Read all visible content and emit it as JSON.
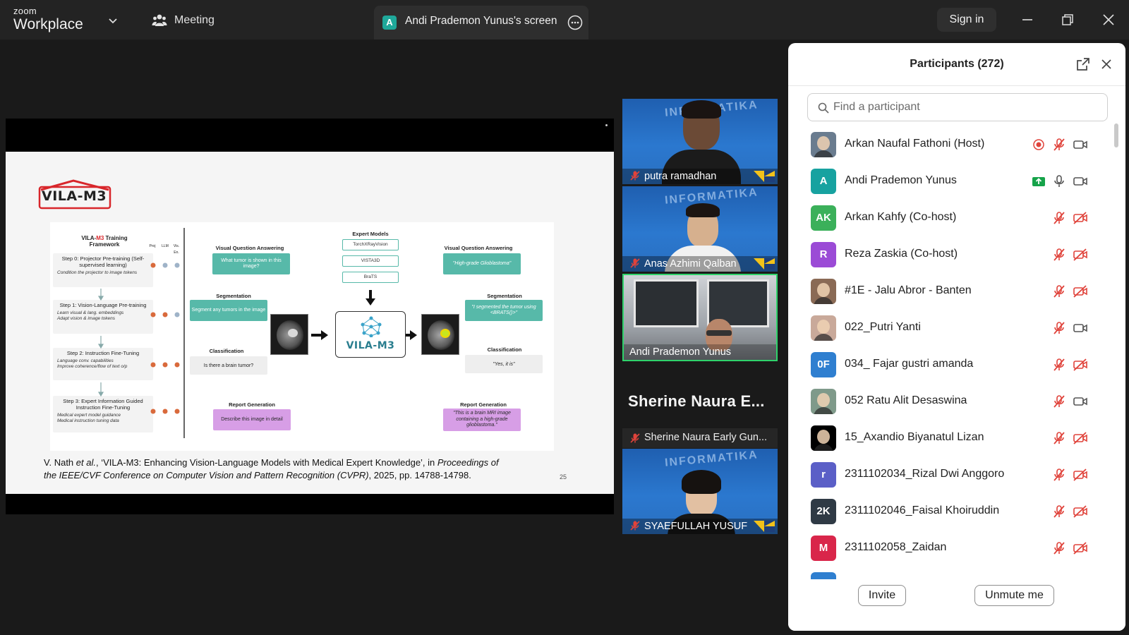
{
  "window": {
    "app_small": "zoom",
    "app_big": "Workplace",
    "meeting_label": "Meeting",
    "screen_badge": "A",
    "screen_label": "Andi Prademon Yunus's screen",
    "signin_label": "Sign in"
  },
  "slide": {
    "logo_text": "VILA-M3",
    "page_number": "25",
    "citation_line1_prefix": "V. Nath ",
    "citation_line1_etal": "et al.",
    "citation_line1_mid": ", ‘VILA-M3: Enhancing Vision-Language Models with Medical Expert Knowledge’, in ",
    "citation_line1_proc": "Proceedings of",
    "citation_line2_italic": "the IEEE/CVF Conference on Computer Vision and Pattern Recognition (CVPR)",
    "citation_line2_rest": ", 2025, pp. 14788-14798.",
    "figure": {
      "framework_title_a": "VILA-",
      "framework_title_b": "M3",
      "framework_title_c": " Training",
      "framework_title_d": "Framework",
      "col_headers": [
        "Proj",
        "LLM",
        "Vis. En."
      ],
      "steps": [
        {
          "title": "Step 0: Projector Pre-training (Self-supervised learning)",
          "bullets": [
            "Condition the projector to image tokens"
          ]
        },
        {
          "title": "Step 1: Vision-Language Pre-training",
          "bullets": [
            "Learn visual & lang. embeddings",
            "Adapt vision & image tokens"
          ]
        },
        {
          "title": "Step 2: Instruction Fine-Tuning",
          "bullets": [
            "Language conv. capabilities",
            "Improve coherence/flow of text o/p"
          ]
        },
        {
          "title": "Step 3: Expert Information Guided Instruction Fine-Tuning",
          "bullets": [
            "Medical expert model guidance",
            "Medical instruction tuning data"
          ]
        }
      ],
      "vqa_left_title": "Visual Question Answering",
      "vqa_left_box": "What tumor is shown in this image?",
      "seg_left_title": "Segmentation",
      "seg_left_box": "Segment any tumors in the image",
      "cls_left_title": "Classification",
      "cls_left_box": "Is there a brain tumor?",
      "rep_left_title": "Report Generation",
      "rep_left_box": "Describe this image in detail",
      "expert_title": "Expert Models",
      "expert_models": [
        "TorchXRayVision",
        "VISTA3D",
        "BraTS"
      ],
      "center_label": "VILA-M3",
      "vqa_right_title": "Visual Question Answering",
      "vqa_right_box": "\"High-grade Glioblastoma\"",
      "seg_right_title": "Segmentation",
      "seg_right_box": "\"I segmented the tumor using <BRATS()>\"",
      "cls_right_title": "Classification",
      "cls_right_box": "\"Yes, it is\"",
      "rep_right_title": "Report Generation",
      "rep_right_box": "\"This is a brain MRI image containing a high-grade glioblastoma.\""
    }
  },
  "videos": [
    {
      "name": "putra ramadhan",
      "banner": "INFORMATIKA"
    },
    {
      "name": "Anas Azhimi Qalban",
      "banner": "INFORMATIKA"
    },
    {
      "name": "Andi Prademon Yunus",
      "banner": ""
    },
    {
      "name": "SYAEFULLAH YUSUF",
      "banner": "INFORMATIKA"
    }
  ],
  "speaker_big_name": "Sherine Naura E...",
  "speaker_strip_name": "Sherine Naura Early Gun...",
  "participants_panel": {
    "title": "Participants (272)",
    "search_placeholder": "Find a participant",
    "invite_label": "Invite",
    "unmute_label": "Unmute me",
    "participants": [
      {
        "name": "Arkan Naufal Fathoni (Host)",
        "avatar": "",
        "avatar_color": "#6a7c8f",
        "mic": "muted",
        "video": "on",
        "extra": "record"
      },
      {
        "name": "Andi Prademon Yunus",
        "avatar": "A",
        "avatar_color": "#17a2a0",
        "mic": "on",
        "video": "on",
        "extra": "share"
      },
      {
        "name": "Arkan Kahfy (Co-host)",
        "avatar": "AK",
        "avatar_color": "#3bb05a",
        "mic": "muted",
        "video": "off",
        "extra": ""
      },
      {
        "name": "Reza Zaskia (Co-host)",
        "avatar": "R",
        "avatar_color": "#9b4bd6",
        "mic": "muted",
        "video": "off",
        "extra": ""
      },
      {
        "name": "#1E - Jalu Abror - Banten",
        "avatar": "",
        "avatar_color": "#8a6a55",
        "mic": "muted",
        "video": "off",
        "extra": ""
      },
      {
        "name": "022_Putri Yanti",
        "avatar": "",
        "avatar_color": "#c9a99a",
        "mic": "muted",
        "video": "on",
        "extra": ""
      },
      {
        "name": "034_ Fajar gustri amanda",
        "avatar": "0F",
        "avatar_color": "#2f7fd0",
        "mic": "muted",
        "video": "off",
        "extra": ""
      },
      {
        "name": "052 Ratu Alit Desaswina",
        "avatar": "",
        "avatar_color": "#7f9a8a",
        "mic": "muted",
        "video": "on",
        "extra": ""
      },
      {
        "name": "15_Axandio Biyanatul Lizan",
        "avatar": "",
        "avatar_color": "#000000",
        "mic": "muted",
        "video": "off",
        "extra": ""
      },
      {
        "name": "2311102034_Rizal Dwi Anggoro",
        "avatar": "r",
        "avatar_color": "#5b5fc7",
        "mic": "muted",
        "video": "off",
        "extra": ""
      },
      {
        "name": "2311102046_Faisal Khoiruddin",
        "avatar": "2K",
        "avatar_color": "#2f3a45",
        "mic": "muted",
        "video": "off",
        "extra": ""
      },
      {
        "name": "2311102058_Zaidan",
        "avatar": "M",
        "avatar_color": "#d9264a",
        "mic": "muted",
        "video": "off",
        "extra": ""
      }
    ]
  },
  "colors": {
    "accent_teal": "#57b9a9",
    "active_speaker_border": "#2fd36b",
    "mute_red": "#e0433b",
    "share_green": "#16a34a"
  },
  "icons": [
    "chevron-down-icon",
    "meeting-people-icon",
    "more-options-icon",
    "minimize-icon",
    "restore-icon",
    "close-icon",
    "popout-icon",
    "search-icon",
    "muted-mic-icon",
    "mic-icon",
    "video-icon",
    "video-off-icon",
    "record-icon",
    "share-screen-icon"
  ]
}
